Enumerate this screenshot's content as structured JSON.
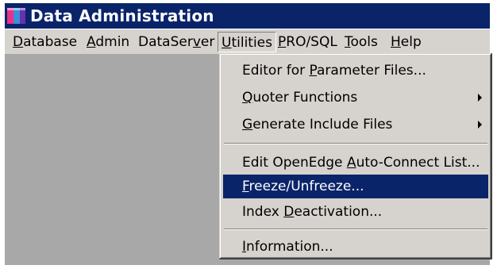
{
  "window": {
    "title": "Data Administration",
    "icon": "progress-app-icon"
  },
  "menubar": {
    "items": [
      {
        "pre": "",
        "key": "D",
        "post": "atabase"
      },
      {
        "pre": "",
        "key": "A",
        "post": "dmin"
      },
      {
        "pre": "DataSer",
        "key": "v",
        "post": "er"
      },
      {
        "pre": "",
        "key": "U",
        "post": "tilities"
      },
      {
        "pre": "",
        "key": "P",
        "post": "RO/SQL"
      },
      {
        "pre": "",
        "key": "T",
        "post": "ools"
      },
      {
        "pre": "",
        "key": "H",
        "post": "elp"
      }
    ],
    "active_index": 3
  },
  "utilities_menu": {
    "items": [
      {
        "pre": "Editor for ",
        "key": "P",
        "post": "arameter Files...",
        "submenu": false
      },
      {
        "pre": "",
        "key": "Q",
        "post": "uoter Functions",
        "submenu": true
      },
      {
        "pre": "",
        "key": "G",
        "post": "enerate Include Files",
        "submenu": true
      },
      {
        "pre": "Edit OpenEdge ",
        "key": "A",
        "post": "uto-Connect List...",
        "submenu": false
      },
      {
        "pre": "",
        "key": "F",
        "post": "reeze/Unfreeze...",
        "submenu": false
      },
      {
        "pre": "Index ",
        "key": "D",
        "post": "eactivation...",
        "submenu": false
      },
      {
        "pre": "",
        "key": "I",
        "post": "nformation...",
        "submenu": false
      }
    ],
    "selected_index": 4
  },
  "colors": {
    "title_bar": "#0a246a",
    "menu_background": "#d6d3ce",
    "selection": "#0a246a",
    "client_area": "#a8a8a8"
  }
}
